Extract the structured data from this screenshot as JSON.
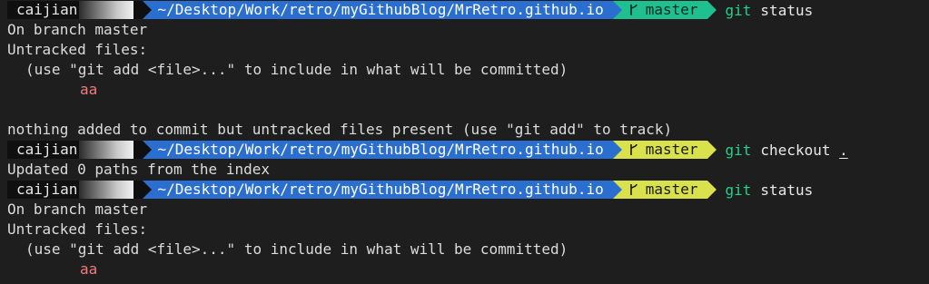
{
  "prompt": {
    "user": "caijian",
    "path": "~/Desktop/Work/retro/myGithubBlog/MrRetro.github.io",
    "branch": "master"
  },
  "block1": {
    "command": "git",
    "args": "status",
    "lines": [
      "On branch master",
      "Untracked files:",
      "(use \"git add <file>...\" to include in what will be committed)",
      "aa",
      "",
      "nothing added to commit but untracked files present (use \"git add\" to track)"
    ]
  },
  "block2": {
    "command": "git",
    "args_main": "checkout",
    "args_dot": ".",
    "output": "Updated 0 paths from the index"
  },
  "block3": {
    "command": "git",
    "args": "status",
    "lines": [
      "On branch master",
      "Untracked files:",
      "(use \"git add <file>...\" to include in what will be committed)",
      "aa"
    ]
  },
  "colors": {
    "background": "#1e1e1e",
    "path_segment": "#2a6fd0",
    "branch_clean": "#1fbf8f",
    "branch_dirty": "#d9e14d",
    "command": "#23d18b",
    "untracked": "#f27a7a"
  }
}
